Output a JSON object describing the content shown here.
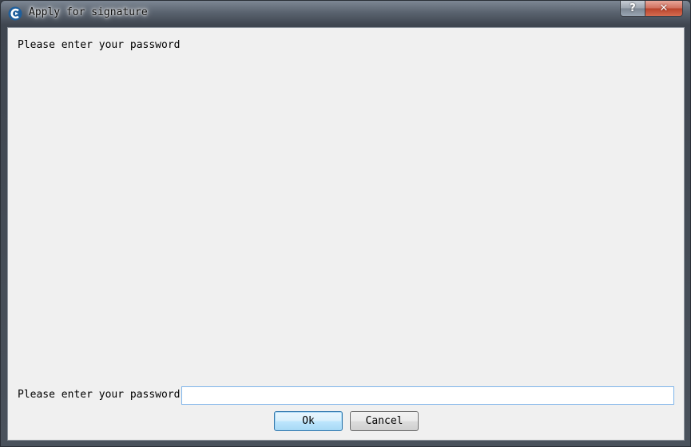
{
  "window": {
    "title": "Apply for signature",
    "help_glyph": "?",
    "close_glyph": "✕",
    "icon": "app-s-icon"
  },
  "dialog": {
    "prompt": "Please enter your password",
    "password_label": "Please enter your password:",
    "password_value": "",
    "ok_label": "Ok",
    "cancel_label": "Cancel"
  },
  "colors": {
    "client_bg": "#f0f0f0",
    "input_border": "#7eb4ea",
    "close_red": "#c74a33"
  }
}
